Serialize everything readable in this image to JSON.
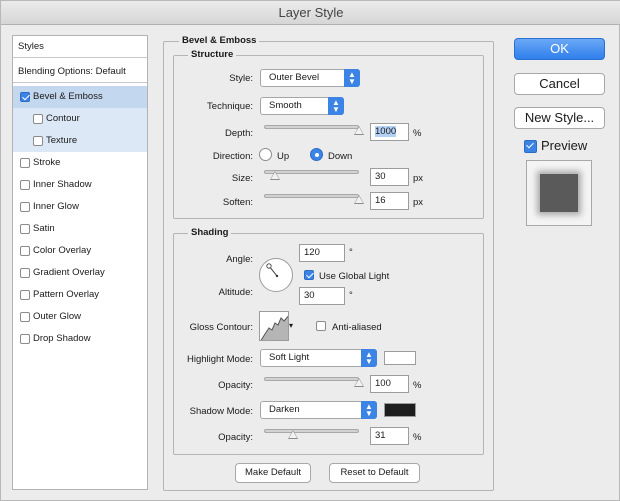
{
  "window": {
    "title": "Layer Style"
  },
  "styles_list": {
    "header": "Styles",
    "blending_options": "Blending Options: Default",
    "items": [
      {
        "label": "Bevel & Emboss",
        "checked": true,
        "selected": true
      },
      {
        "label": "Contour",
        "checked": false,
        "sub": true
      },
      {
        "label": "Texture",
        "checked": false,
        "sub": true
      },
      {
        "label": "Stroke",
        "checked": false
      },
      {
        "label": "Inner Shadow",
        "checked": false
      },
      {
        "label": "Inner Glow",
        "checked": false
      },
      {
        "label": "Satin",
        "checked": false
      },
      {
        "label": "Color Overlay",
        "checked": false
      },
      {
        "label": "Gradient Overlay",
        "checked": false
      },
      {
        "label": "Pattern Overlay",
        "checked": false
      },
      {
        "label": "Outer Glow",
        "checked": false
      },
      {
        "label": "Drop Shadow",
        "checked": false
      }
    ]
  },
  "panel": {
    "title": "Bevel & Emboss",
    "structure": {
      "title": "Structure",
      "style_label": "Style:",
      "style_value": "Outer Bevel",
      "technique_label": "Technique:",
      "technique_value": "Smooth",
      "depth_label": "Depth:",
      "depth_value": "1000",
      "depth_unit": "%",
      "depth_level": 1.0,
      "direction_label": "Direction:",
      "direction_up": "Up",
      "direction_down": "Down",
      "direction_selected": "Down",
      "size_label": "Size:",
      "size_value": "30",
      "size_unit": "px",
      "size_level": 0.12,
      "soften_label": "Soften:",
      "soften_value": "16",
      "soften_unit": "px",
      "soften_level": 1.0
    },
    "shading": {
      "title": "Shading",
      "angle_label": "Angle:",
      "angle_value": "120",
      "angle_unit": "°",
      "use_global_light": "Use Global Light",
      "use_global_light_checked": true,
      "altitude_label": "Altitude:",
      "altitude_value": "30",
      "altitude_unit": "°",
      "gloss_contour_label": "Gloss Contour:",
      "anti_aliased": "Anti-aliased",
      "anti_aliased_checked": false,
      "highlight_mode_label": "Highlight Mode:",
      "highlight_mode_value": "Soft Light",
      "highlight_color": "#ffffff",
      "highlight_opacity_label": "Opacity:",
      "highlight_opacity_value": "100",
      "highlight_opacity_unit": "%",
      "highlight_opacity_level": 1.0,
      "shadow_mode_label": "Shadow Mode:",
      "shadow_mode_value": "Darken",
      "shadow_color": "#1e1e1e",
      "shadow_opacity_label": "Opacity:",
      "shadow_opacity_value": "31",
      "shadow_opacity_unit": "%",
      "shadow_opacity_level": 0.31
    },
    "make_default": "Make Default",
    "reset_to_default": "Reset to Default"
  },
  "actions": {
    "ok": "OK",
    "cancel": "Cancel",
    "new_style": "New Style...",
    "preview_label": "Preview",
    "preview_checked": true
  },
  "colors": {
    "accent": "#3c83e6",
    "selected_row": "#c3d7ef"
  }
}
